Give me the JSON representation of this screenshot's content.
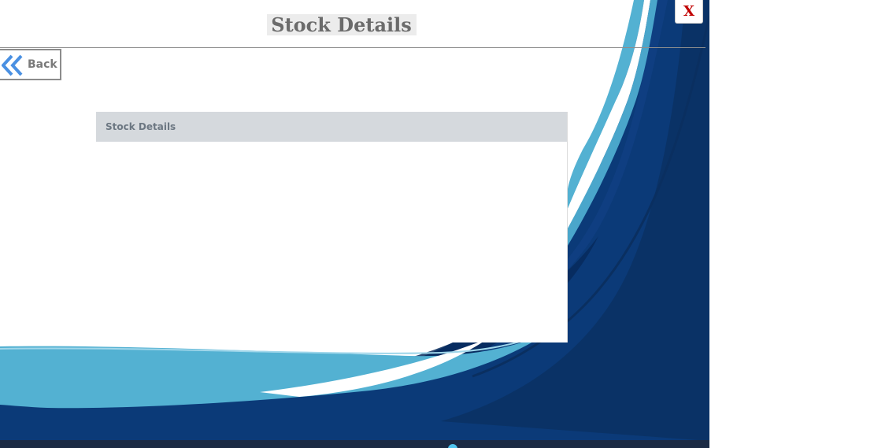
{
  "page": {
    "title": "Stock Details"
  },
  "toolbar": {
    "close_label": "X",
    "back_label": "Back",
    "back_icon": "double-chevron-left-icon"
  },
  "panel": {
    "header": "Stock Details"
  },
  "colors": {
    "close_text": "#c00000",
    "back_icon": "#4a90e2",
    "panel_header_bg": "#d5d9dd",
    "background_dark_blue": "#0b3a78",
    "background_light_blue": "#53b1d2"
  }
}
